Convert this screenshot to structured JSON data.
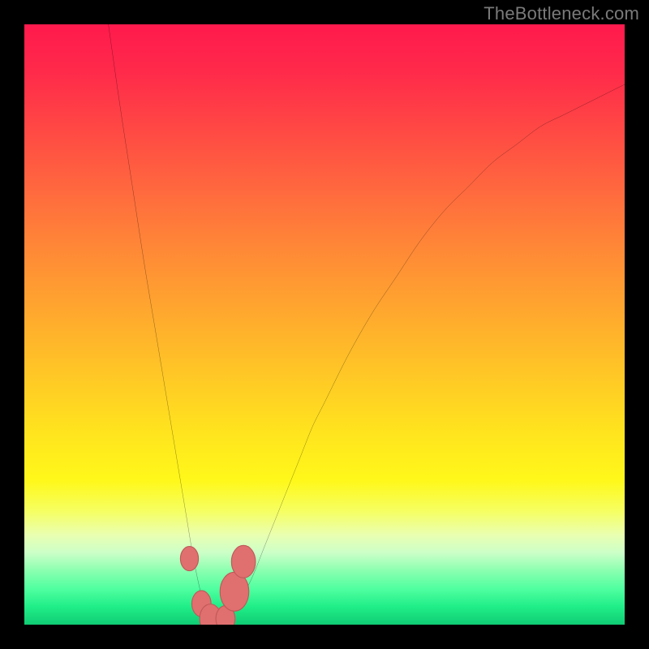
{
  "watermark": "TheBottleneck.com",
  "gradient_css": "background: linear-gradient(to bottom, #ff1a4d 0%, #ff2a4a 8%, #ff4a44 18%, #ff6a3e 28%, #ff8a36 38%, #ffa82e 48%, #ffc626 58%, #ffe41e 68%, #fff81a 76%, #f6ff60 81%, #eaffb0 85%, #ccffc8 88%, #8affb0 91%, #50ffa0 94%, #20ee88 97%, #10cc74 100%);",
  "colors": {
    "curve": "#000000",
    "marker_fill": "#e07070",
    "marker_stroke": "#c05858"
  },
  "chart_data": {
    "type": "line",
    "title": "",
    "xlabel": "",
    "ylabel": "",
    "xlim": [
      0,
      100
    ],
    "ylim": [
      0,
      100
    ],
    "series": [
      {
        "name": "curve",
        "x": [
          14,
          16,
          18,
          20,
          22,
          24,
          26,
          27,
          28,
          29,
          30,
          31,
          32,
          33,
          34,
          36,
          38,
          40,
          42,
          44,
          46,
          48,
          50,
          54,
          58,
          62,
          66,
          70,
          74,
          78,
          82,
          86,
          90,
          94,
          98,
          100
        ],
        "y": [
          100,
          86,
          73,
          60,
          48,
          36,
          24,
          18,
          12,
          7,
          3,
          1,
          0,
          0,
          1,
          4,
          8,
          13,
          18,
          23,
          28,
          33,
          37,
          45,
          52,
          58,
          64,
          69,
          73,
          77,
          80,
          83,
          85,
          87,
          89,
          90
        ]
      }
    ],
    "markers": [
      {
        "x": 27.5,
        "y": 11,
        "r": 1.5
      },
      {
        "x": 29.5,
        "y": 3.5,
        "r": 1.6
      },
      {
        "x": 31.0,
        "y": 1.0,
        "r": 1.8
      },
      {
        "x": 33.5,
        "y": 1.0,
        "r": 1.6
      },
      {
        "x": 35.0,
        "y": 5.5,
        "r": 2.4
      },
      {
        "x": 36.5,
        "y": 10.5,
        "r": 2.0
      }
    ]
  }
}
